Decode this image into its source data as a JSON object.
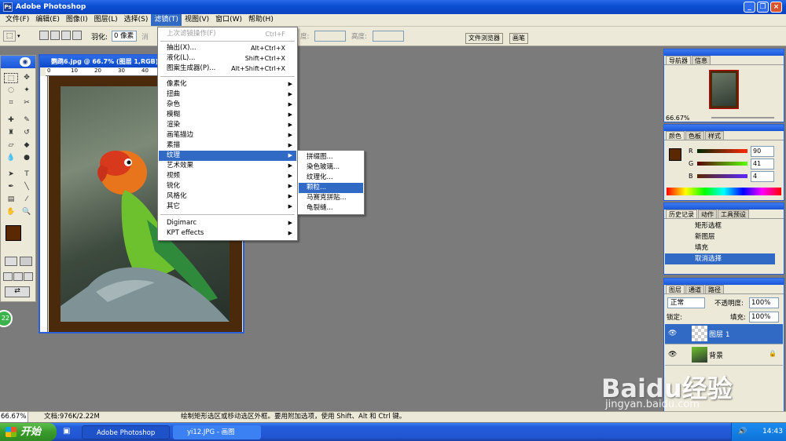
{
  "app": {
    "title": "Adobe Photoshop"
  },
  "menubar": [
    "文件(F)",
    "编辑(E)",
    "图像(I)",
    "图层(L)",
    "选择(S)",
    "滤镜(T)",
    "视图(V)",
    "窗口(W)",
    "帮助(H)"
  ],
  "options": {
    "feather_label": "羽化:",
    "feather_value": "0 像素",
    "antialias_label": "消",
    "width_label": "度:",
    "height_label": "高度:",
    "tab_file_browser": "文件浏览器",
    "tab_brushes": "画笔"
  },
  "document": {
    "title": "鹦鹉6.jpg @ 66.7% (图层 1,RGB)",
    "ruler_marks": [
      "0",
      "10",
      "20",
      "30",
      "40"
    ]
  },
  "filter_menu": {
    "last_filter": {
      "label": "上次滤镜操作(F)",
      "shortcut": "Ctrl+F"
    },
    "extract": {
      "label": "抽出(X)...",
      "shortcut": "Alt+Ctrl+X"
    },
    "liquify": {
      "label": "液化(L)...",
      "shortcut": "Shift+Ctrl+X"
    },
    "pattern_maker": {
      "label": "图案生成器(P)...",
      "shortcut": "Alt+Shift+Ctrl+X"
    },
    "groups": [
      "像素化",
      "扭曲",
      "杂色",
      "模糊",
      "渲染",
      "画笔描边",
      "素描",
      "纹理",
      "艺术效果",
      "视频",
      "锐化",
      "风格化",
      "其它"
    ],
    "plugins": [
      "Digimarc",
      "KPT effects"
    ]
  },
  "texture_submenu": [
    "拼缀图...",
    "染色玻璃...",
    "纹理化...",
    "颗粒...",
    "马赛克拼贴...",
    "龟裂缝..."
  ],
  "navigator": {
    "tabs": [
      "导航器",
      "信息"
    ],
    "zoom": "66.67%"
  },
  "color_panel": {
    "tabs": [
      "颜色",
      "色板",
      "样式"
    ],
    "r": "90",
    "g": "41",
    "b": "4",
    "swatch": "#5a2904"
  },
  "history_panel": {
    "tabs": [
      "历史记录",
      "动作",
      "工具预设"
    ],
    "items": [
      "矩形选框",
      "新图层",
      "填充",
      "取消选择"
    ]
  },
  "layers_panel": {
    "tabs": [
      "图层",
      "通道",
      "路径"
    ],
    "blend_mode": "正常",
    "opacity_label": "不透明度:",
    "opacity": "100%",
    "lock_label": "锁定:",
    "fill_label": "填充:",
    "fill": "100%",
    "layers": [
      "图层 1",
      "背景"
    ]
  },
  "status": {
    "zoom": "66.67%",
    "doc_size": "文档:976K/2.22M",
    "hint": "绘制矩形选区或移动选区外框。要用附加选项，使用 Shift、Alt 和 Ctrl 键。"
  },
  "taskbar": {
    "start": "开始",
    "tasks": [
      "Adobe Photoshop",
      "yi12.JPG - 画图"
    ],
    "time": "14:43"
  },
  "watermark": {
    "brand": "Baidu经验",
    "url": "jingyan.baidu.com"
  },
  "colors": {
    "title_blue": "#0c4fd3",
    "menu_bg": "#ece9d8",
    "highlight": "#316ac5",
    "canvas_gray": "#7b7b7b",
    "frame_brown": "#4b2a0c",
    "start_green": "#3a9b2c"
  }
}
